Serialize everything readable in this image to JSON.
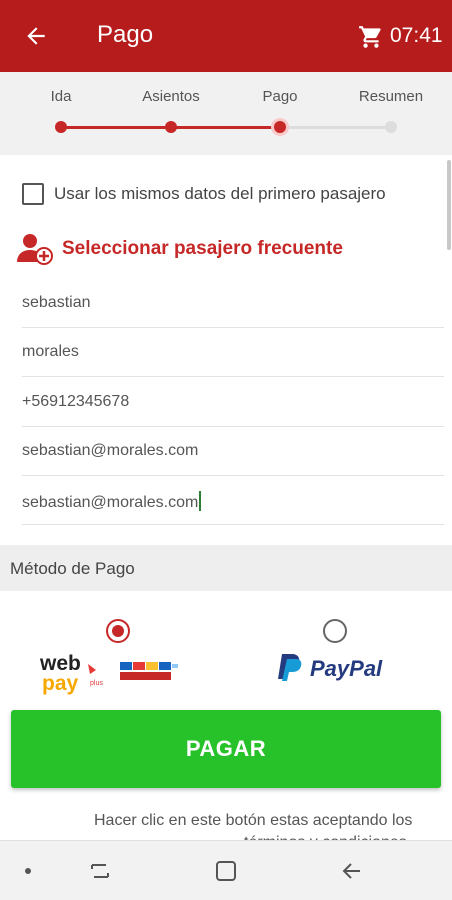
{
  "appbar": {
    "title": "Pago",
    "timer": "07:41",
    "background": "#b71c1c"
  },
  "stepper": {
    "steps": [
      "Ida",
      "Asientos",
      "Pago",
      "Resumen"
    ],
    "current_step": 3,
    "active_color": "#c62828",
    "inactive_color": "#dddddd"
  },
  "form": {
    "same_data_checkbox_label": "Usar los mismos datos del primero pasajero",
    "same_data_checked": false,
    "frequent_passenger_label": "Seleccionar pasajero frecuente",
    "fields": {
      "first_name": "sebastian",
      "last_name": "morales",
      "phone": "+56912345678",
      "email": "sebastian@morales.com",
      "email_confirm": "sebastian@morales.com"
    }
  },
  "payment": {
    "header": "Método de Pago",
    "options": [
      {
        "name": "webpay",
        "logo_text_1": "web",
        "logo_text_2": "pay",
        "logo_badge": "plus",
        "selected": true
      },
      {
        "name": "paypal",
        "logo_text": "PayPal",
        "selected": false
      }
    ],
    "pay_button_label": "PAGAR",
    "pay_button_color": "#27c229",
    "terms_line_1": "Hacer clic en este botón estas aceptando los",
    "terms_line_2": "términos y condiciones"
  },
  "navbar": {
    "icons": [
      "dot-icon",
      "recents-icon",
      "home-icon",
      "back-icon"
    ]
  }
}
